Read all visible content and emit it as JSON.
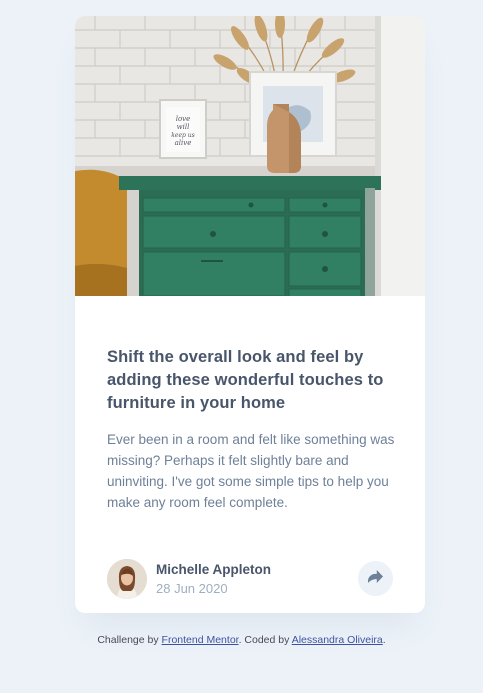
{
  "article": {
    "headline": "Shift the overall look and feel by adding these wonderful touches to furniture in your home",
    "description": "Ever been in a room and felt like something was missing? Perhaps it felt slightly bare and uninviting. I've got some simple tips to help you make any room feel complete."
  },
  "author": {
    "name": "Michelle Appleton",
    "date": "28 Jun 2020"
  },
  "share": {
    "icon": "share-icon"
  },
  "image": {
    "frame_text_1": "love",
    "frame_text_2": "will",
    "frame_text_3": "keep us",
    "frame_text_4": "alive"
  },
  "footer": {
    "prefix": "Challenge by ",
    "link1": "Frontend Mentor",
    "middle": ". Coded by ",
    "link2": "Alessandra Oliveira",
    "suffix": "."
  },
  "colors": {
    "background": "#ecf2f8",
    "heading": "#48556a",
    "body": "#6e8098",
    "muted": "#9eafc2",
    "drawer_green": "#2f7a5e"
  }
}
